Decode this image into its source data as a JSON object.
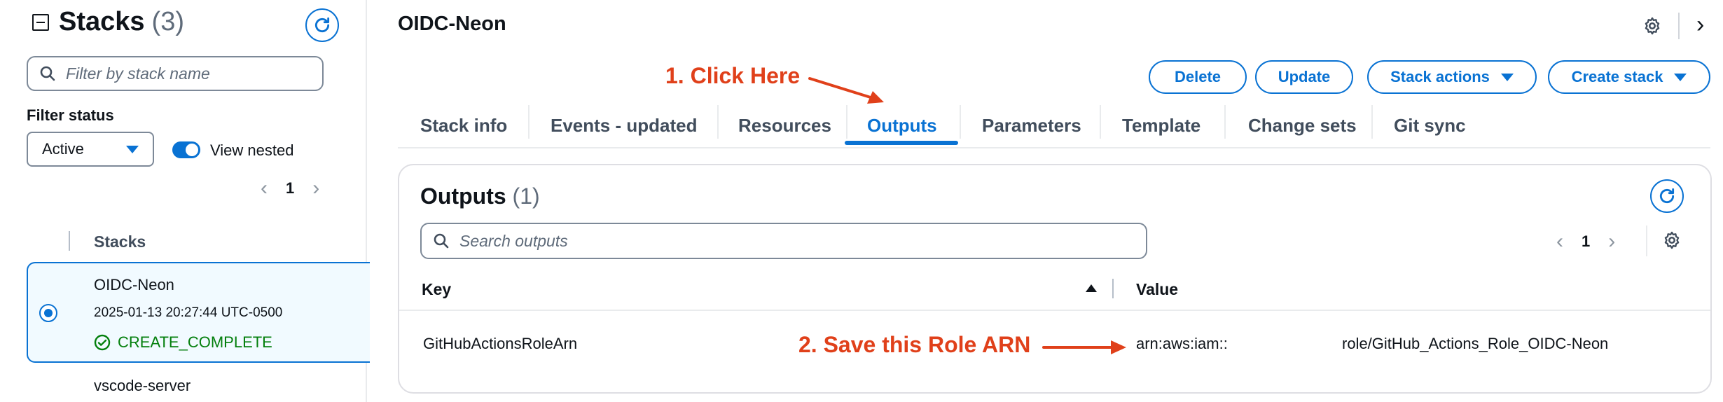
{
  "sidebar": {
    "title": "Stacks",
    "count": "(3)",
    "filter_placeholder": "Filter by stack name",
    "filter_status_label": "Filter status",
    "status_select_value": "Active",
    "view_nested_label": "View nested",
    "page_number": "1",
    "column_header": "Stacks",
    "stacks": [
      {
        "name": "OIDC-Neon",
        "timestamp": "2025-01-13 20:27:44 UTC-0500",
        "status": "CREATE_COMPLETE"
      },
      {
        "name": "vscode-server"
      }
    ]
  },
  "header": {
    "title": "OIDC-Neon",
    "buttons": {
      "delete": "Delete",
      "update": "Update",
      "stack_actions": "Stack actions",
      "create_stack": "Create stack"
    }
  },
  "tabs": [
    {
      "label": "Stack info"
    },
    {
      "label": "Events - updated"
    },
    {
      "label": "Resources"
    },
    {
      "label": "Outputs",
      "active": true
    },
    {
      "label": "Parameters"
    },
    {
      "label": "Template"
    },
    {
      "label": "Change sets"
    },
    {
      "label": "Git sync"
    }
  ],
  "outputs": {
    "title": "Outputs",
    "count": "(1)",
    "search_placeholder": "Search outputs",
    "page_number": "1",
    "columns": {
      "key": "Key",
      "value": "Value"
    },
    "rows": [
      {
        "key": "GitHubActionsRoleArn",
        "value_prefix": "arn:aws:iam::",
        "value_suffix": "role/GitHub_Actions_Role_OIDC-Neon"
      }
    ]
  },
  "annotations": {
    "step1": "1. Click Here",
    "step2": "2. Save this Role ARN"
  },
  "colors": {
    "accent": "#0972d3",
    "annotation": "#e0401a",
    "success": "#037f0c"
  },
  "icons": [
    "collapse-icon",
    "refresh-icon",
    "search-icon",
    "caret-down-icon",
    "chevron-left-icon",
    "chevron-right-icon",
    "success-icon",
    "gear-icon",
    "sort-ascending-icon"
  ]
}
